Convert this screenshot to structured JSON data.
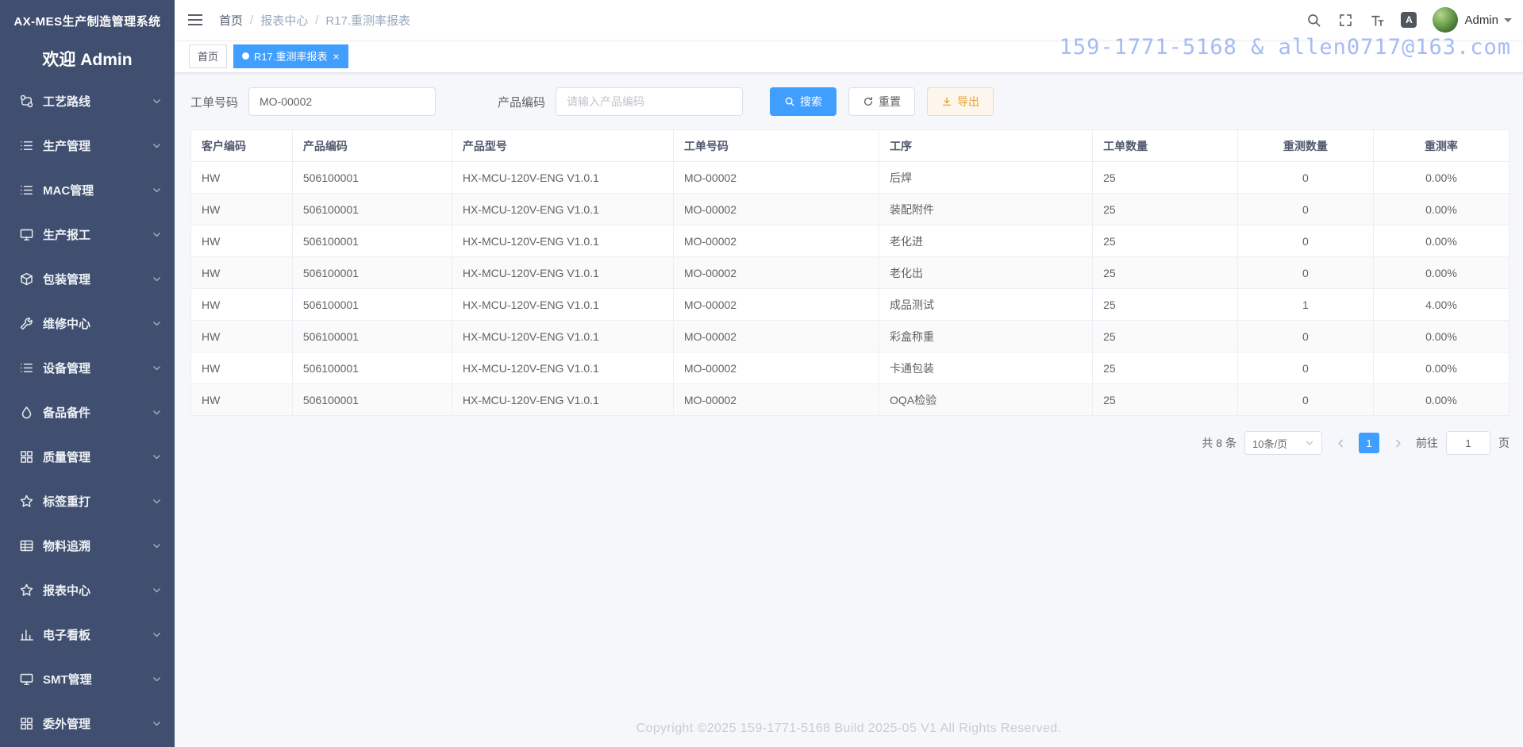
{
  "app": {
    "accent_color": "#409eff",
    "sidebar_color": "#404f6f"
  },
  "sidebar": {
    "title": "AX-MES生产制造管理系统",
    "welcome": "欢迎 Admin",
    "items": [
      {
        "icon": "route",
        "label": "工艺路线"
      },
      {
        "icon": "list",
        "label": "生产管理"
      },
      {
        "icon": "list",
        "label": "MAC管理"
      },
      {
        "icon": "monitor",
        "label": "生产报工"
      },
      {
        "icon": "package",
        "label": "包装管理"
      },
      {
        "icon": "wrench",
        "label": "维修中心"
      },
      {
        "icon": "list",
        "label": "设备管理"
      },
      {
        "icon": "drop",
        "label": "备品备件"
      },
      {
        "icon": "grid",
        "label": "质量管理"
      },
      {
        "icon": "star",
        "label": "标签重打"
      },
      {
        "icon": "table",
        "label": "物料追溯"
      },
      {
        "icon": "star",
        "label": "报表中心"
      },
      {
        "icon": "chart",
        "label": "电子看板"
      },
      {
        "icon": "monitor",
        "label": "SMT管理"
      },
      {
        "icon": "grid",
        "label": "委外管理"
      }
    ]
  },
  "header": {
    "breadcrumb": [
      "首页",
      "报表中心",
      "R17.重测率报表"
    ],
    "user": "Admin"
  },
  "watermark": "159-1771-5168 & allen0717@163.com",
  "tabs": [
    {
      "label": "首页",
      "active": false,
      "closable": false
    },
    {
      "label": "R17.重测率报表",
      "active": true,
      "closable": true
    }
  ],
  "filters": {
    "work_order_label": "工单号码",
    "work_order_value": "MO-00002",
    "product_code_label": "产品编码",
    "product_code_placeholder": "请输入产品编码",
    "search_button": "搜索",
    "reset_button": "重置",
    "export_button": "导出"
  },
  "table": {
    "columns": [
      "客户编码",
      "产品编码",
      "产品型号",
      "工单号码",
      "工序",
      "工单数量",
      "重测数量",
      "重测率"
    ],
    "rows": [
      [
        "HW",
        "506100001",
        "HX-MCU-120V-ENG V1.0.1",
        "MO-00002",
        "后焊",
        "25",
        "0",
        "0.00%"
      ],
      [
        "HW",
        "506100001",
        "HX-MCU-120V-ENG V1.0.1",
        "MO-00002",
        "装配附件",
        "25",
        "0",
        "0.00%"
      ],
      [
        "HW",
        "506100001",
        "HX-MCU-120V-ENG V1.0.1",
        "MO-00002",
        "老化进",
        "25",
        "0",
        "0.00%"
      ],
      [
        "HW",
        "506100001",
        "HX-MCU-120V-ENG V1.0.1",
        "MO-00002",
        "老化出",
        "25",
        "0",
        "0.00%"
      ],
      [
        "HW",
        "506100001",
        "HX-MCU-120V-ENG V1.0.1",
        "MO-00002",
        "成品测试",
        "25",
        "1",
        "4.00%"
      ],
      [
        "HW",
        "506100001",
        "HX-MCU-120V-ENG V1.0.1",
        "MO-00002",
        "彩盒称重",
        "25",
        "0",
        "0.00%"
      ],
      [
        "HW",
        "506100001",
        "HX-MCU-120V-ENG V1.0.1",
        "MO-00002",
        "卡通包装",
        "25",
        "0",
        "0.00%"
      ],
      [
        "HW",
        "506100001",
        "HX-MCU-120V-ENG V1.0.1",
        "MO-00002",
        "OQA检验",
        "25",
        "0",
        "0.00%"
      ]
    ]
  },
  "pagination": {
    "total": "共 8 条",
    "page_size": "10条/页",
    "current_page": "1",
    "goto_label": "前往",
    "goto_value": "1",
    "page_unit": "页"
  },
  "footer": {
    "text": "Copyright ©2025 159-1771-5168 Build 2025-05 V1 All Rights Reserved."
  }
}
